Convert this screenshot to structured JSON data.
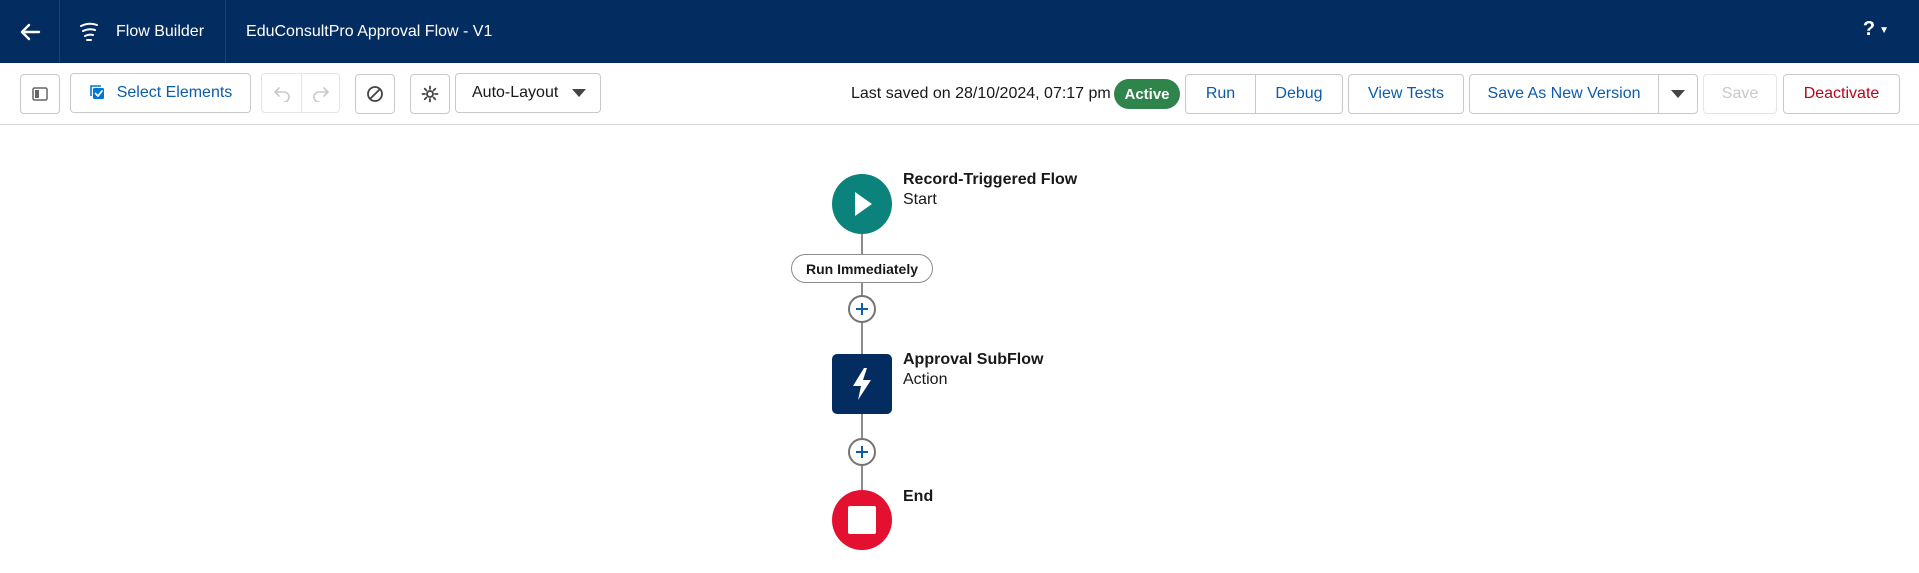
{
  "header": {
    "app_name": "Flow Builder",
    "flow_title": "EduConsultPro Approval Flow - V1",
    "help_label": "?"
  },
  "toolbar": {
    "select_elements_label": "Select Elements",
    "layout_mode": "Auto-Layout",
    "last_saved_text": "Last saved on 28/10/2024, 07:17 pm",
    "status_badge": "Active",
    "run_label": "Run",
    "debug_label": "Debug",
    "view_tests_label": "View Tests",
    "save_as_new_version_label": "Save As New Version",
    "save_label": "Save",
    "deactivate_label": "Deactivate"
  },
  "canvas": {
    "start_node": {
      "title": "Record-Triggered Flow",
      "subtitle": "Start",
      "icon": "play-icon"
    },
    "run_path_label": "Run Immediately",
    "action_node": {
      "title": "Approval SubFlow",
      "subtitle": "Action",
      "icon": "lightning-icon"
    },
    "end_node": {
      "title": "End",
      "icon": "stop-icon"
    }
  },
  "colors": {
    "header_bg": "#032d60",
    "start_node": "#0b827c",
    "action_node": "#032d60",
    "end_node": "#e3102f",
    "active_badge": "#2e844a",
    "link_blue": "#0b5cab",
    "deactivate_red": "#ba0517"
  }
}
